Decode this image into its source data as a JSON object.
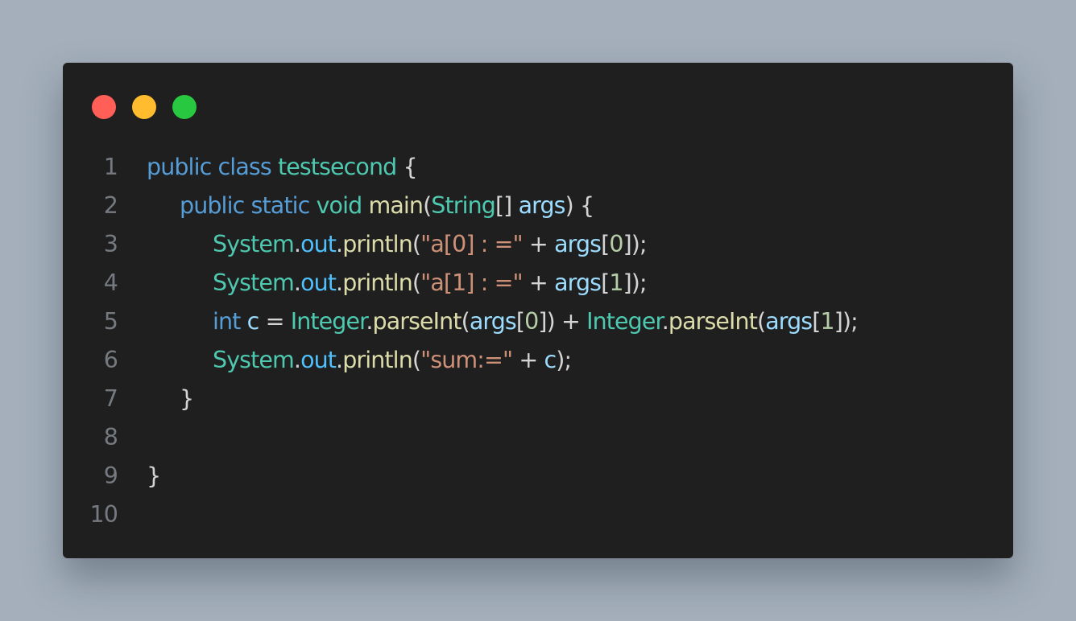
{
  "window": {
    "buttons": [
      {
        "name": "close",
        "color": "#ff5f57"
      },
      {
        "name": "minimize",
        "color": "#febc2e"
      },
      {
        "name": "maximize",
        "color": "#28c840"
      }
    ]
  },
  "colors": {
    "keyword": "#569cd6",
    "type": "#4ec9b0",
    "function": "#dcdcaa",
    "variable": "#9cdcfe",
    "string": "#ce9178",
    "number": "#b5cea8",
    "punctuation": "#d4d4d4",
    "field": "#4fc1ff"
  },
  "editor": {
    "lines": [
      {
        "number": "1",
        "indent": 0,
        "tokens": [
          {
            "text": "public",
            "kind": "keyword"
          },
          {
            "text": " ",
            "kind": "punctuation"
          },
          {
            "text": "class",
            "kind": "keyword"
          },
          {
            "text": " ",
            "kind": "punctuation"
          },
          {
            "text": "testsecond",
            "kind": "type"
          },
          {
            "text": " {",
            "kind": "punctuation"
          }
        ]
      },
      {
        "number": "2",
        "indent": 1,
        "tokens": [
          {
            "text": "public",
            "kind": "keyword"
          },
          {
            "text": " ",
            "kind": "punctuation"
          },
          {
            "text": "static",
            "kind": "keyword"
          },
          {
            "text": " ",
            "kind": "punctuation"
          },
          {
            "text": "void",
            "kind": "type"
          },
          {
            "text": " ",
            "kind": "punctuation"
          },
          {
            "text": "main",
            "kind": "function"
          },
          {
            "text": "(",
            "kind": "punctuation"
          },
          {
            "text": "String",
            "kind": "type"
          },
          {
            "text": "[] ",
            "kind": "punctuation"
          },
          {
            "text": "args",
            "kind": "variable"
          },
          {
            "text": ") {",
            "kind": "punctuation"
          }
        ]
      },
      {
        "number": "3",
        "indent": 2,
        "tokens": [
          {
            "text": "System",
            "kind": "type"
          },
          {
            "text": ".",
            "kind": "punctuation"
          },
          {
            "text": "out",
            "kind": "field"
          },
          {
            "text": ".",
            "kind": "punctuation"
          },
          {
            "text": "println",
            "kind": "function"
          },
          {
            "text": "(",
            "kind": "punctuation"
          },
          {
            "text": "\"a[0] : =\"",
            "kind": "string"
          },
          {
            "text": " + ",
            "kind": "punctuation"
          },
          {
            "text": "args",
            "kind": "variable"
          },
          {
            "text": "[",
            "kind": "punctuation"
          },
          {
            "text": "0",
            "kind": "number"
          },
          {
            "text": "]);",
            "kind": "punctuation"
          }
        ]
      },
      {
        "number": "4",
        "indent": 2,
        "tokens": [
          {
            "text": "System",
            "kind": "type"
          },
          {
            "text": ".",
            "kind": "punctuation"
          },
          {
            "text": "out",
            "kind": "field"
          },
          {
            "text": ".",
            "kind": "punctuation"
          },
          {
            "text": "println",
            "kind": "function"
          },
          {
            "text": "(",
            "kind": "punctuation"
          },
          {
            "text": "\"a[1] : =\"",
            "kind": "string"
          },
          {
            "text": " + ",
            "kind": "punctuation"
          },
          {
            "text": "args",
            "kind": "variable"
          },
          {
            "text": "[",
            "kind": "punctuation"
          },
          {
            "text": "1",
            "kind": "number"
          },
          {
            "text": "]);",
            "kind": "punctuation"
          }
        ]
      },
      {
        "number": "5",
        "indent": 2,
        "tokens": [
          {
            "text": "int",
            "kind": "keyword"
          },
          {
            "text": " ",
            "kind": "punctuation"
          },
          {
            "text": "c",
            "kind": "variable"
          },
          {
            "text": " = ",
            "kind": "punctuation"
          },
          {
            "text": "Integer",
            "kind": "type"
          },
          {
            "text": ".",
            "kind": "punctuation"
          },
          {
            "text": "parseInt",
            "kind": "function"
          },
          {
            "text": "(",
            "kind": "punctuation"
          },
          {
            "text": "args",
            "kind": "variable"
          },
          {
            "text": "[",
            "kind": "punctuation"
          },
          {
            "text": "0",
            "kind": "number"
          },
          {
            "text": "]) + ",
            "kind": "punctuation"
          },
          {
            "text": "Integer",
            "kind": "type"
          },
          {
            "text": ".",
            "kind": "punctuation"
          },
          {
            "text": "parseInt",
            "kind": "function"
          },
          {
            "text": "(",
            "kind": "punctuation"
          },
          {
            "text": "args",
            "kind": "variable"
          },
          {
            "text": "[",
            "kind": "punctuation"
          },
          {
            "text": "1",
            "kind": "number"
          },
          {
            "text": "]);",
            "kind": "punctuation"
          }
        ]
      },
      {
        "number": "6",
        "indent": 2,
        "tokens": [
          {
            "text": "System",
            "kind": "type"
          },
          {
            "text": ".",
            "kind": "punctuation"
          },
          {
            "text": "out",
            "kind": "field"
          },
          {
            "text": ".",
            "kind": "punctuation"
          },
          {
            "text": "println",
            "kind": "function"
          },
          {
            "text": "(",
            "kind": "punctuation"
          },
          {
            "text": "\"sum:=\"",
            "kind": "string"
          },
          {
            "text": " + ",
            "kind": "punctuation"
          },
          {
            "text": "c",
            "kind": "variable"
          },
          {
            "text": ");",
            "kind": "punctuation"
          }
        ]
      },
      {
        "number": "7",
        "indent": 1,
        "tokens": [
          {
            "text": "}",
            "kind": "punctuation"
          }
        ]
      },
      {
        "number": "8",
        "indent": 0,
        "tokens": []
      },
      {
        "number": "9",
        "indent": 0,
        "tokens": [
          {
            "text": "}",
            "kind": "punctuation"
          }
        ]
      },
      {
        "number": "10",
        "indent": 0,
        "tokens": []
      }
    ]
  }
}
